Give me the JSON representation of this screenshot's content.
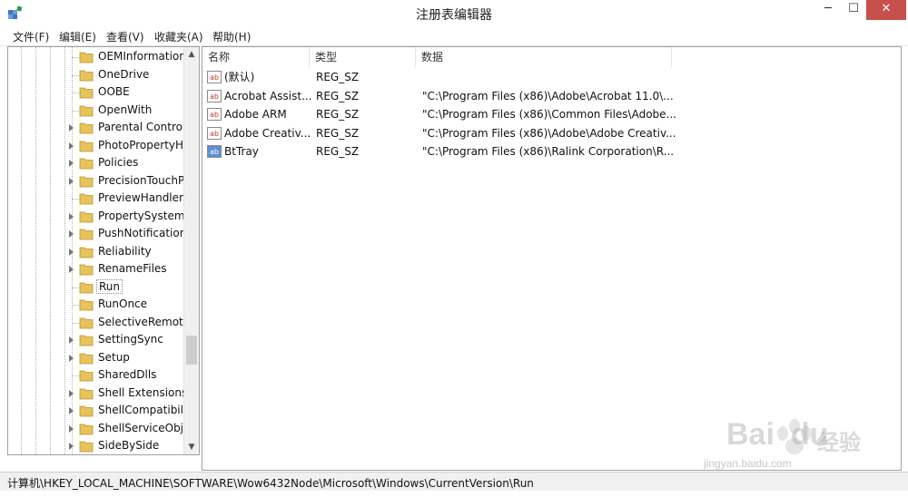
{
  "window": {
    "title": "注册表编辑器",
    "minimize": "─",
    "maximize": "☐",
    "close": "✕"
  },
  "menu": [
    {
      "label": "文件(F)"
    },
    {
      "label": "编辑(E)"
    },
    {
      "label": "查看(V)"
    },
    {
      "label": "收藏夹(A)"
    },
    {
      "label": "帮助(H)"
    }
  ],
  "tree": {
    "items": [
      {
        "label": "OEMInformation",
        "expandable": false
      },
      {
        "label": "OneDrive",
        "expandable": false
      },
      {
        "label": "OOBE",
        "expandable": false
      },
      {
        "label": "OpenWith",
        "expandable": false
      },
      {
        "label": "Parental Controls",
        "expandable": true
      },
      {
        "label": "PhotoPropertyHa",
        "expandable": true
      },
      {
        "label": "Policies",
        "expandable": true
      },
      {
        "label": "PrecisionTouchP",
        "expandable": true
      },
      {
        "label": "PreviewHandlers",
        "expandable": false
      },
      {
        "label": "PropertySystem",
        "expandable": true
      },
      {
        "label": "PushNotification",
        "expandable": true
      },
      {
        "label": "Reliability",
        "expandable": true
      },
      {
        "label": "RenameFiles",
        "expandable": true
      },
      {
        "label": "Run",
        "expandable": false,
        "selected": true
      },
      {
        "label": "RunOnce",
        "expandable": false
      },
      {
        "label": "SelectiveRemote",
        "expandable": false
      },
      {
        "label": "SettingSync",
        "expandable": true
      },
      {
        "label": "Setup",
        "expandable": true
      },
      {
        "label": "SharedDlls",
        "expandable": false
      },
      {
        "label": "Shell Extensions",
        "expandable": true
      },
      {
        "label": "ShellCompatibilit",
        "expandable": true
      },
      {
        "label": "ShellServiceObje",
        "expandable": true
      },
      {
        "label": "SideBySide",
        "expandable": true
      }
    ],
    "scroll_up": "▲",
    "scroll_down": "▼"
  },
  "list": {
    "columns": {
      "name": "名称",
      "type": "类型",
      "data": "数据"
    },
    "rows": [
      {
        "icon": "string-value-icon",
        "name": "(默认)",
        "type": "REG_SZ",
        "data": ""
      },
      {
        "icon": "string-value-icon",
        "name": "Acrobat Assist...",
        "type": "REG_SZ",
        "data": "\"C:\\Program Files (x86)\\Adobe\\Acrobat 11.0\\..."
      },
      {
        "icon": "string-value-icon",
        "name": "Adobe ARM",
        "type": "REG_SZ",
        "data": "\"C:\\Program Files (x86)\\Common Files\\Adobe..."
      },
      {
        "icon": "string-value-icon",
        "name": "Adobe Creativ...",
        "type": "REG_SZ",
        "data": "\"C:\\Program Files (x86)\\Adobe\\Adobe Creativ..."
      },
      {
        "icon": "string-value-icon-selected",
        "name": "BtTray",
        "type": "REG_SZ",
        "data": "\"C:\\Program Files (x86)\\Ralink Corporation\\R..."
      }
    ]
  },
  "status": {
    "path": "计算机\\HKEY_LOCAL_MACHINE\\SOFTWARE\\Wow6432Node\\Microsoft\\Windows\\CurrentVersion\\Run"
  },
  "watermark": {
    "brand": "Bai",
    "brand2": "du",
    "cn": "经验",
    "url": "jingyan.baidu.com"
  },
  "colors": {
    "close_button": "#c7504a",
    "folder": "#e8c25a",
    "selected_icon": "#5a8fd8"
  }
}
